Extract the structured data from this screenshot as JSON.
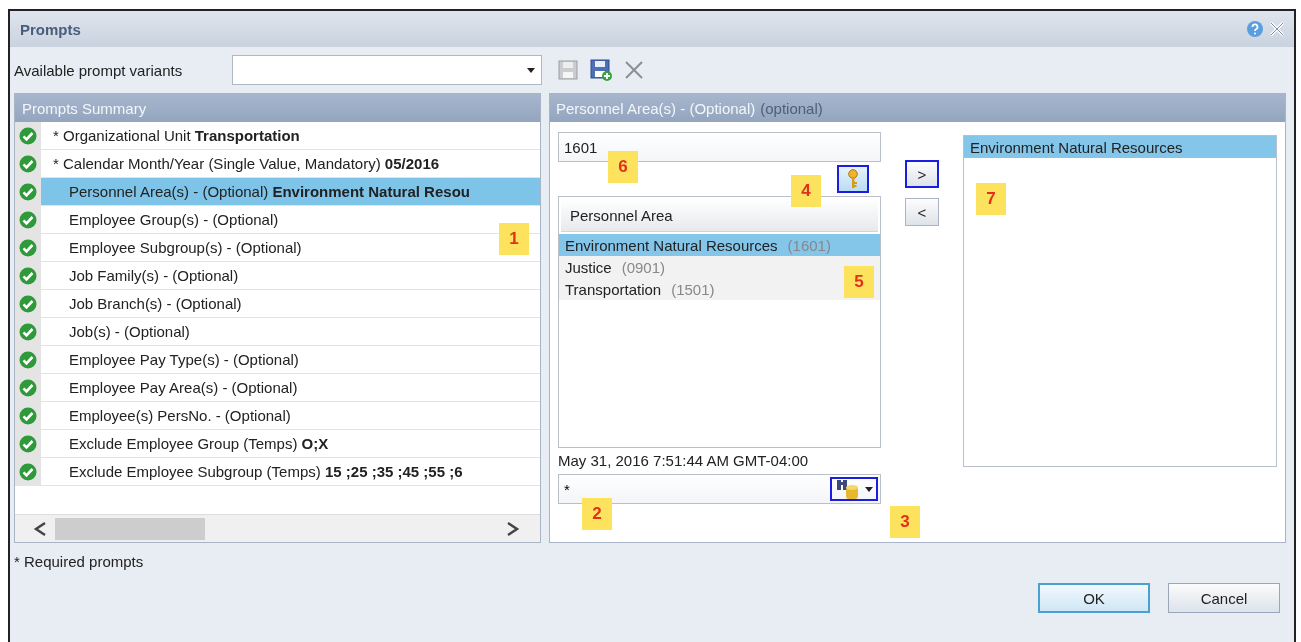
{
  "window": {
    "title": "Prompts"
  },
  "variants": {
    "label": "Available prompt variants"
  },
  "summary": {
    "title": "Prompts Summary",
    "rows": [
      {
        "text": "* Organizational Unit **Transportation**",
        "required": true,
        "valid": true,
        "selected": false
      },
      {
        "text": "* Calendar Month/Year (Single Value, Mandatory) **05/2016**",
        "required": true,
        "valid": true,
        "selected": false
      },
      {
        "text": "Personnel Area(s) - (Optional) **Environment Natural Resou**",
        "required": false,
        "valid": true,
        "selected": true
      },
      {
        "text": "Employee Group(s) - (Optional)",
        "required": false,
        "valid": true,
        "selected": false
      },
      {
        "text": "Employee Subgroup(s) - (Optional)",
        "required": false,
        "valid": true,
        "selected": false
      },
      {
        "text": "Job Family(s) - (Optional)",
        "required": false,
        "valid": true,
        "selected": false
      },
      {
        "text": "Job Branch(s) - (Optional)",
        "required": false,
        "valid": true,
        "selected": false
      },
      {
        "text": "Job(s) - (Optional)",
        "required": false,
        "valid": true,
        "selected": false
      },
      {
        "text": "Employee Pay Type(s) - (Optional)",
        "required": false,
        "valid": true,
        "selected": false
      },
      {
        "text": "Employee Pay Area(s) - (Optional)",
        "required": false,
        "valid": true,
        "selected": false
      },
      {
        "text": "Employee(s) PersNo. - (Optional)",
        "required": false,
        "valid": true,
        "selected": false
      },
      {
        "text": "Exclude Employee Group (Temps) **O;X**",
        "required": false,
        "valid": true,
        "selected": false
      },
      {
        "text": "Exclude Employee Subgroup (Temps) **15 ;25 ;35 ;45 ;55 ;6**",
        "required": false,
        "valid": true,
        "selected": false
      }
    ]
  },
  "selection": {
    "title": "Personnel Area(s) - (Optional)",
    "note": "(optional)",
    "search": {
      "value": "1601"
    },
    "key_button": {
      "highlighted": true
    },
    "list": {
      "column": "Personnel Area",
      "items": [
        {
          "name": "Environment Natural Resources",
          "code": "(1601)",
          "selected": true
        },
        {
          "name": "Justice",
          "code": "(0901)",
          "selected": false
        },
        {
          "name": "Transportation",
          "code": "(1501)",
          "selected": false
        }
      ]
    },
    "timestamp": "May 31, 2016 7:51:44 AM GMT-04:00",
    "filter": {
      "value": "*",
      "highlighted": true
    },
    "add_button": {
      "label": ">",
      "highlighted": true
    },
    "remove_button": {
      "label": "<",
      "highlighted": false
    },
    "selected_items": [
      {
        "name": "Environment Natural Resources",
        "selected": true
      }
    ]
  },
  "callouts": [
    {
      "label": "6"
    },
    {
      "label": "4"
    },
    {
      "label": "7"
    },
    {
      "label": "1"
    },
    {
      "label": "5"
    },
    {
      "label": "2"
    },
    {
      "label": "3"
    }
  ],
  "footer": {
    "note": "* Required prompts",
    "buttons": [
      {
        "label": "OK",
        "default": true
      },
      {
        "label": "Cancel",
        "default": false
      }
    ]
  }
}
